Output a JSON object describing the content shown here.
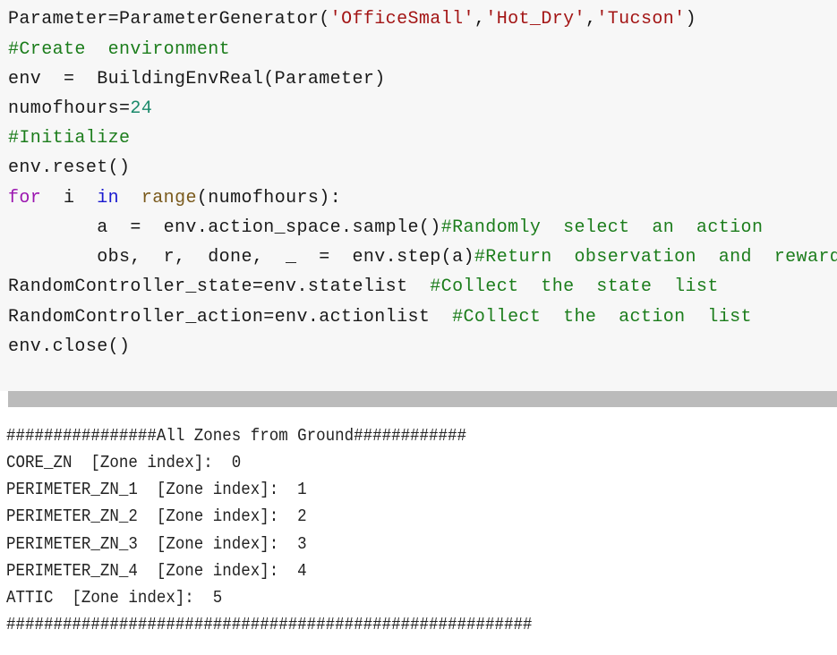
{
  "code_cell": {
    "lines": [
      {
        "parts": [
          {
            "t": "Parameter=ParameterGenerator(",
            "c": ""
          },
          {
            "t": "'OfficeSmall'",
            "c": "str"
          },
          {
            "t": ",",
            "c": ""
          },
          {
            "t": "'Hot_Dry'",
            "c": "str"
          },
          {
            "t": ",",
            "c": ""
          },
          {
            "t": "'Tucson'",
            "c": "str"
          },
          {
            "t": ")",
            "c": ""
          }
        ]
      },
      {
        "parts": [
          {
            "t": "#Create  environment",
            "c": "com"
          }
        ]
      },
      {
        "parts": [
          {
            "t": "env  =  BuildingEnvReal(Parameter)",
            "c": ""
          }
        ]
      },
      {
        "parts": [
          {
            "t": "numofhours=",
            "c": ""
          },
          {
            "t": "24",
            "c": "num"
          }
        ]
      },
      {
        "parts": [
          {
            "t": "#Initialize",
            "c": "com"
          }
        ]
      },
      {
        "parts": [
          {
            "t": "env.reset()",
            "c": ""
          }
        ]
      },
      {
        "parts": [
          {
            "t": "for",
            "c": "kw"
          },
          {
            "t": "  i  ",
            "c": ""
          },
          {
            "t": "in",
            "c": "kw2"
          },
          {
            "t": "  ",
            "c": ""
          },
          {
            "t": "range",
            "c": "bi"
          },
          {
            "t": "(numofhours):",
            "c": ""
          }
        ]
      },
      {
        "parts": [
          {
            "t": "        a  =  env.action_space.sample()",
            "c": ""
          },
          {
            "t": "#Randomly  select  an  action",
            "c": "com"
          }
        ]
      },
      {
        "parts": [
          {
            "t": "        obs,  r,  done,  _  =  env.step(a)",
            "c": ""
          },
          {
            "t": "#Return  observation  and  reward",
            "c": "com"
          }
        ]
      },
      {
        "parts": [
          {
            "t": "RandomController_state=env.statelist  ",
            "c": ""
          },
          {
            "t": "#Collect  the  state  list",
            "c": "com"
          }
        ]
      },
      {
        "parts": [
          {
            "t": "RandomController_action=env.actionlist  ",
            "c": ""
          },
          {
            "t": "#Collect  the  action  list",
            "c": "com"
          }
        ]
      },
      {
        "parts": [
          {
            "t": "env.close()",
            "c": ""
          }
        ]
      }
    ]
  },
  "output": {
    "lines": [
      "################All Zones from Ground############",
      "CORE_ZN  [Zone index]:  0",
      "PERIMETER_ZN_1  [Zone index]:  1",
      "PERIMETER_ZN_2  [Zone index]:  2",
      "PERIMETER_ZN_3  [Zone index]:  3",
      "PERIMETER_ZN_4  [Zone index]:  4",
      "ATTIC  [Zone index]:  5",
      "########################################################"
    ]
  },
  "colors": {
    "code_bg": "#f7f7f7",
    "string": "#a31515",
    "comment": "#1c7d1c",
    "number": "#1b8a6b",
    "keyword_for": "#9b16b0",
    "keyword_in": "#1a1ad0",
    "builtin": "#7a5a1c",
    "scrollbar": "#bbbbbb"
  }
}
